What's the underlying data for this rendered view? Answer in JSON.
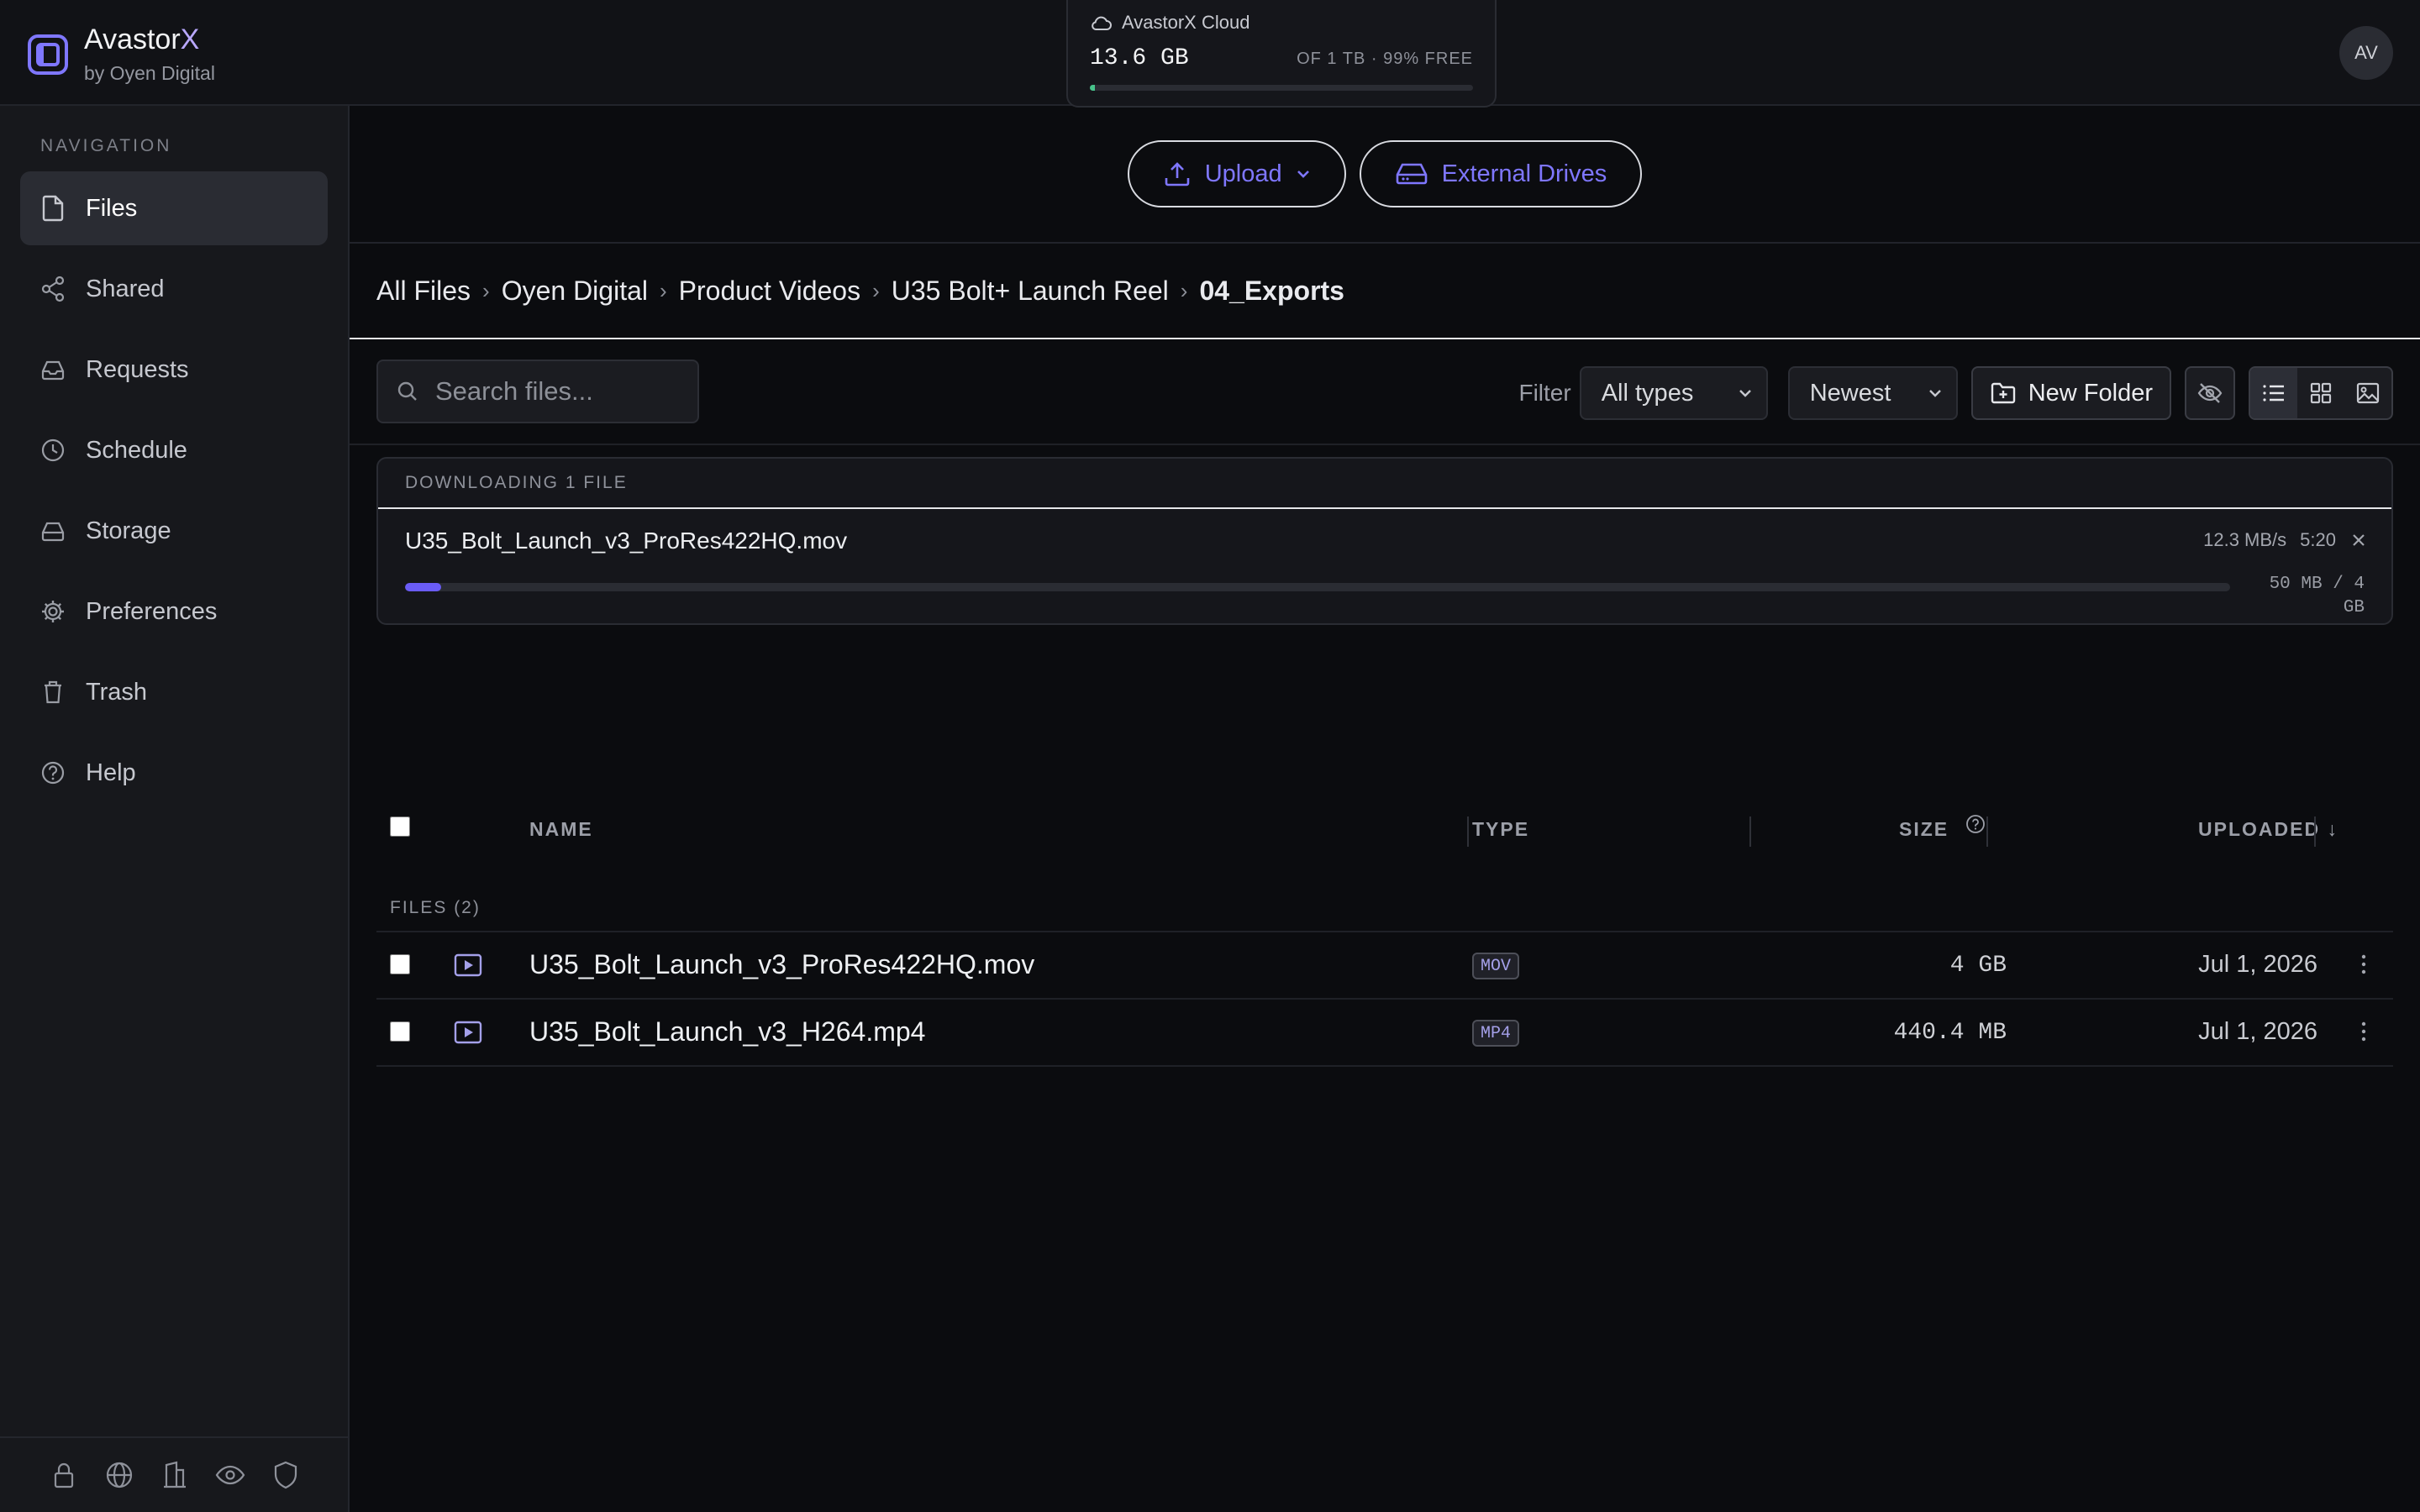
{
  "app": {
    "name_prefix": "Avastor",
    "name_suffix": "X",
    "byline": "by Oyen Digital"
  },
  "cloud": {
    "title": "AvastorX Cloud",
    "used": "13.6 GB",
    "capacity": "OF 1 TB · 99% FREE",
    "used_fraction": 0.0136,
    "bar_color": "#47c28a"
  },
  "user": {
    "initials": "AV"
  },
  "sidebar": {
    "title": "NAVIGATION",
    "items": [
      {
        "label": "Files",
        "icon": "file-icon",
        "active": true
      },
      {
        "label": "Shared",
        "icon": "share-icon"
      },
      {
        "label": "Requests",
        "icon": "inbox-icon"
      },
      {
        "label": "Schedule",
        "icon": "clock-icon"
      },
      {
        "label": "Storage",
        "icon": "storage-icon"
      },
      {
        "label": "Preferences",
        "icon": "gear-icon"
      },
      {
        "label": "Trash",
        "icon": "trash-icon"
      },
      {
        "label": "Help",
        "icon": "help-icon"
      }
    ],
    "footer_icons": [
      "lock-icon",
      "globe-icon",
      "building-icon",
      "eye-icon",
      "shield-icon"
    ]
  },
  "actions": {
    "upload": "Upload",
    "external_drives": "External Drives"
  },
  "breadcrumb": [
    "All Files",
    "Oyen Digital",
    "Product Videos",
    "U35 Bolt+ Launch Reel",
    "04_Exports"
  ],
  "toolbar": {
    "search_placeholder": "Search files...",
    "filter_label": "Filter",
    "filter_value": "All types",
    "sort_value": "Newest",
    "new_folder": "New Folder"
  },
  "download": {
    "header": "DOWNLOADING 1 FILE",
    "file_name": "U35_Bolt_Launch_v3_ProRes422HQ.mov",
    "speed": "12.3 MB/s",
    "eta": "5:20",
    "progress_line1": "50 MB / 4",
    "progress_line2": "GB",
    "progress_fraction": 0.02,
    "accent": "#6a5cf6"
  },
  "table": {
    "headers": {
      "name": "NAME",
      "type": "TYPE",
      "size": "SIZE",
      "uploaded": "UPLOADED ↓"
    },
    "group_label": "FILES (2)",
    "rows": [
      {
        "name": "U35_Bolt_Launch_v3_ProRes422HQ.mov",
        "type": "MOV",
        "size": "4 GB",
        "uploaded": "Jul 1, 2026"
      },
      {
        "name": "U35_Bolt_Launch_v3_H264.mp4",
        "type": "MP4",
        "size": "440.4 MB",
        "uploaded": "Jul 1, 2026"
      }
    ]
  }
}
